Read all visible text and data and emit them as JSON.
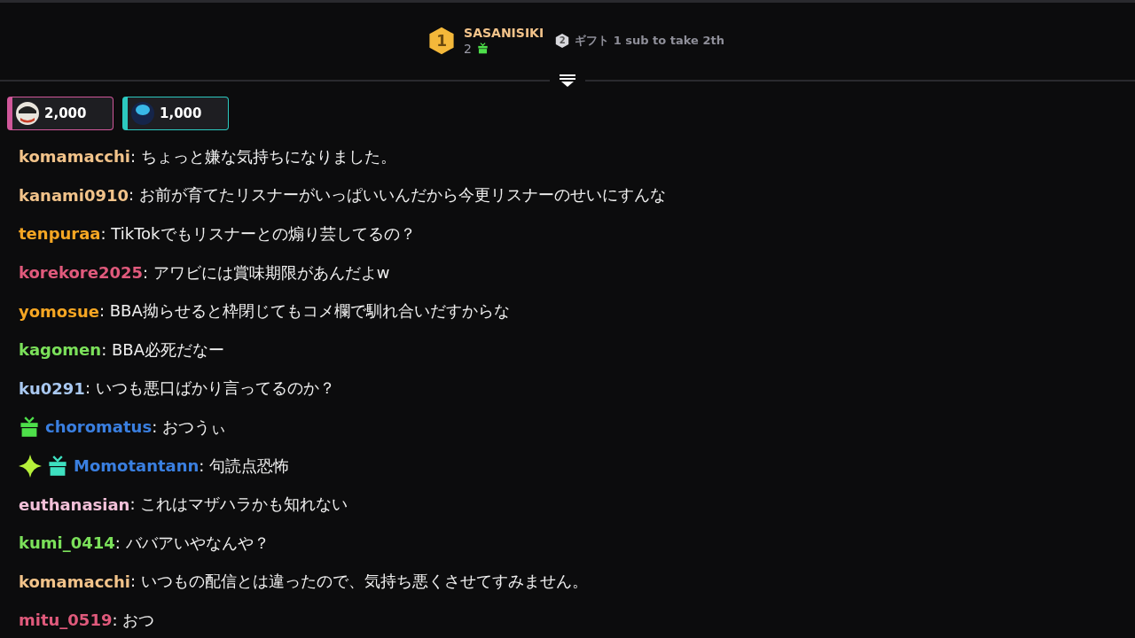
{
  "leader": {
    "rank": "1",
    "name": "SASANISIKI",
    "count": "2",
    "next_rank": "2",
    "next_text": "ギフト 1 sub to take 2th"
  },
  "pinned": [
    {
      "amount": "2,000",
      "color": "#d0579a"
    },
    {
      "amount": "1,000",
      "color": "#2cc9c0"
    }
  ],
  "messages": [
    {
      "user": "komamacchi",
      "color": "#f2c38a",
      "text": ": ちょっと嫌な気持ちになりました。"
    },
    {
      "user": "kanami0910",
      "color": "#f2c38a",
      "text": ": お前が育てたリスナーがいっぱいいんだから今更リスナーのせいにすんな"
    },
    {
      "user": "tenpuraa",
      "color": "#f5a623",
      "text": ": TikTokでもリスナーとの煽り芸してるの？"
    },
    {
      "user": "korekore2025",
      "color": "#e05a7c",
      "text": ": アワビには賞味期限があんだよw"
    },
    {
      "user": "yomosue",
      "color": "#f5a623",
      "text": ": BBA拗らせると枠閉じてもコメ欄で馴れ合いだすからな"
    },
    {
      "user": "kagomen",
      "color": "#7be05a",
      "text": ": BBA必死だなー"
    },
    {
      "user": "ku0291",
      "color": "#a9c8f0",
      "text": ": いつも悪口ばかり言ってるのか？"
    },
    {
      "user": "choromatus",
      "color": "#3a7fe0",
      "text": ": おつうぃ",
      "badges": [
        {
          "kind": "gift",
          "color": "#4ee04a"
        }
      ]
    },
    {
      "user": "Momotantann",
      "color": "#3a7fe0",
      "text": ": 句読点恐怖",
      "badges": [
        {
          "kind": "sparkle",
          "color": "#b6f03a"
        },
        {
          "kind": "gift",
          "color": "#3ee0c0"
        }
      ]
    },
    {
      "user": "euthanasian",
      "color": "#f2c0d8",
      "text": ": これはマザハラかも知れない"
    },
    {
      "user": "kumi_0414",
      "color": "#7be05a",
      "text": ": ババアいやなんや？"
    },
    {
      "user": "komamacchi",
      "color": "#f2c38a",
      "text": ": いつもの配信とは違ったので、気持ち悪くさせてすみません。"
    },
    {
      "user": "mitu_0519",
      "color": "#e05a7c",
      "text": ": おつ"
    }
  ]
}
